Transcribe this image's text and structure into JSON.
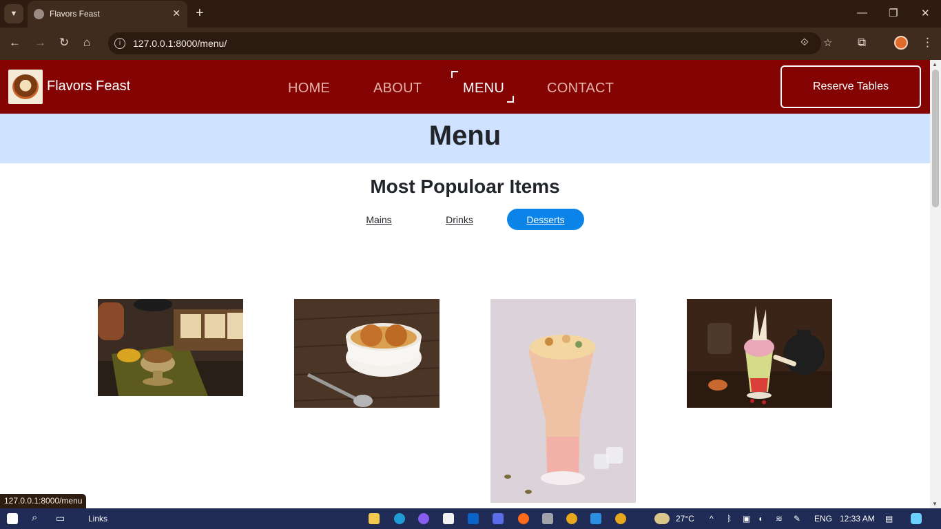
{
  "browser": {
    "tab_title": "Flavors Feast",
    "url": "127.0.0.1:8000/menu/",
    "status_url": "127.0.0.1:8000/menu"
  },
  "site": {
    "brand": "Flavors Feast",
    "nav": [
      {
        "label": "HOME",
        "active": false
      },
      {
        "label": "ABOUT",
        "active": false
      },
      {
        "label": "MENU",
        "active": true
      },
      {
        "label": "CONTACT",
        "active": false
      }
    ],
    "reserve_label": "Reserve Tables",
    "nav_color": "#840404",
    "hero_color": "#cfe2ff"
  },
  "hero": {
    "title": "Menu"
  },
  "section": {
    "subtitle": "Most Populoar Items",
    "filters": [
      {
        "label": "Mains",
        "active": false
      },
      {
        "label": "Drinks",
        "active": false
      },
      {
        "label": "Desserts",
        "active": true
      }
    ],
    "active_color": "#0a84e8"
  },
  "dishes": [
    {
      "icon": "pudding-bowl-image"
    },
    {
      "icon": "gulab-jamun-image"
    },
    {
      "icon": "milkshake-glass-image"
    },
    {
      "icon": "ice-cream-sundae-image"
    }
  ],
  "taskbar": {
    "links_label": "Links",
    "temperature": "27°C",
    "language": "ENG",
    "time": "12:33 AM"
  }
}
